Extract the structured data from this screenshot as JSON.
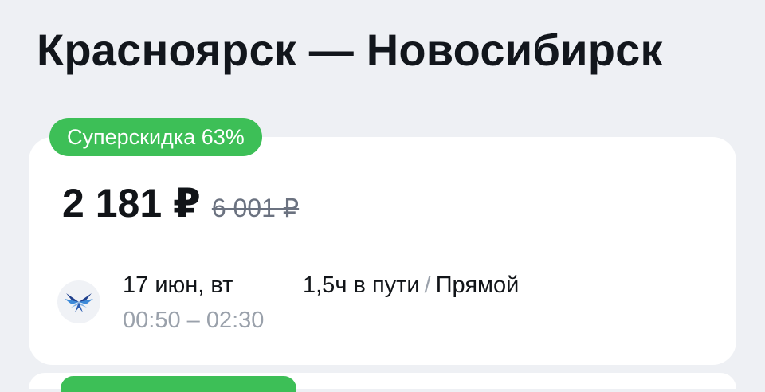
{
  "route": {
    "title": "Красноярск — Новосибирск"
  },
  "offer": {
    "badge": "Суперскидка 63%",
    "price_current": "2 181 ₽",
    "price_old": "6 001 ₽",
    "date": "17 июн, вт",
    "time_range": "00:50 – 02:30",
    "duration": "1,5ч в пути",
    "separator": "/",
    "stops": "Прямой",
    "airline_icon": "bird-wings-icon"
  },
  "colors": {
    "background": "#eef0f4",
    "card": "#ffffff",
    "badge": "#3dbf57",
    "muted_text": "#9aa1ab",
    "airline_blue": "#1f3f8c"
  }
}
